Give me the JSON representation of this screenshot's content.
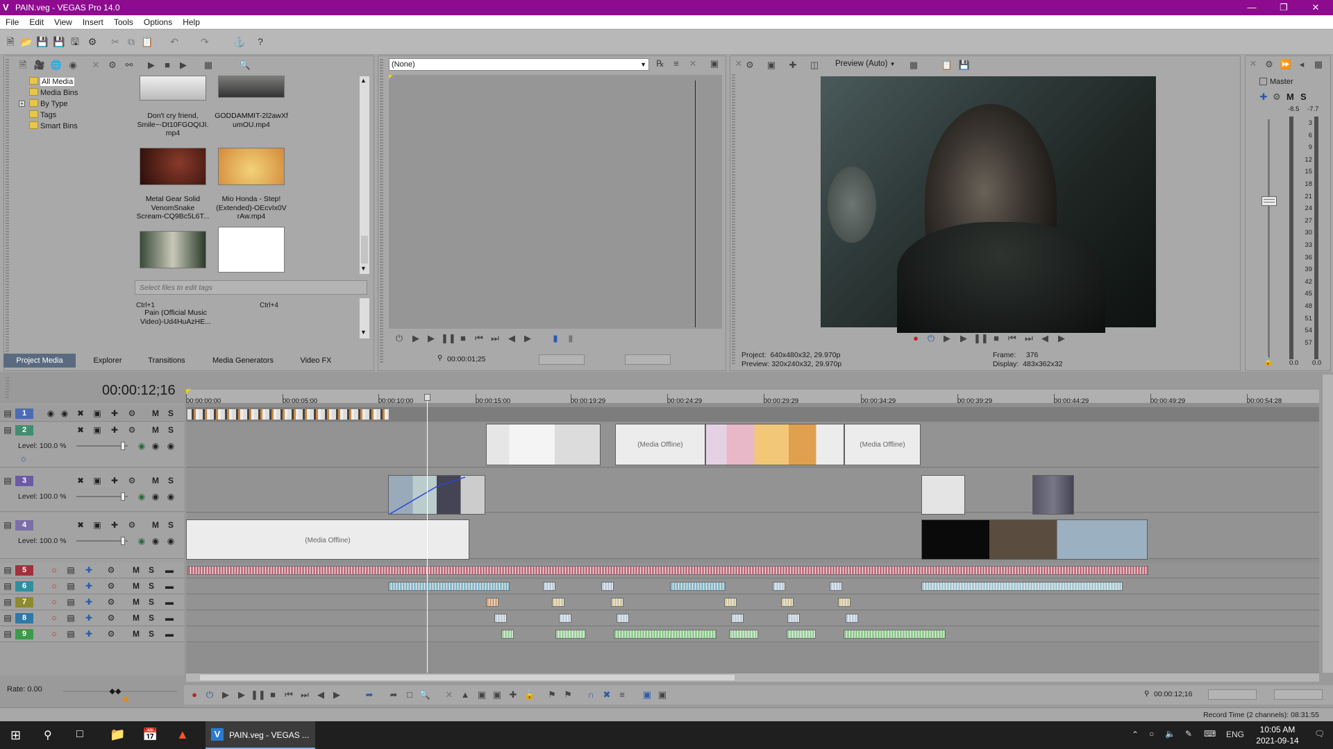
{
  "window": {
    "title": "PAIN.veg - VEGAS Pro 14.0",
    "accent": "#8e0a8e"
  },
  "menu": [
    "File",
    "Edit",
    "View",
    "Insert",
    "Tools",
    "Options",
    "Help"
  ],
  "project_media": {
    "tree": [
      "All Media",
      "Media Bins",
      "By Type",
      "Tags",
      "Smart Bins"
    ],
    "items": [
      {
        "caption": "Don't cry friend, Smile~-Dt10FGOQIJI.mp4",
        "lines": [
          "Don't cry friend,",
          "Smile~-Dt10FGOQIJI.",
          "mp4"
        ]
      },
      {
        "caption": "GODDAMMIT-2l2awXf umOU.mp4",
        "lines": [
          "GODDAMMIT-2l2awXf",
          "umOU.mp4"
        ]
      },
      {
        "caption": "Metal Gear Solid VenomSnake Scream-CQ9Bc5L6T...",
        "lines": [
          "Metal Gear Solid",
          "VenomSnake",
          "Scream-CQ9Bc5L6T..."
        ]
      },
      {
        "caption": "Mio Honda - Step! (Extended)-OEcvIx0V rAw.mp4",
        "lines": [
          "Mio Honda - Step!",
          "(Extended)-OEcvIx0V",
          "rAw.mp4"
        ]
      }
    ],
    "tags_placeholder": "Select files to edit tags",
    "tag_shortcuts": [
      "Ctrl+1",
      "Ctrl+4"
    ],
    "extra_caption_lines": [
      "Pain (Official Music",
      "Video)-Ud4HuAzHE..."
    ],
    "tabs": [
      "Project Media",
      "Explorer",
      "Transitions",
      "Media Generators",
      "Video FX"
    ]
  },
  "trimmer": {
    "selected": "(None)",
    "timecode": "00:00:01;25"
  },
  "preview": {
    "mode": "Preview (Auto)",
    "project_label": "Project:",
    "project_value": "640x480x32, 29.970p",
    "preview_label": "Preview:",
    "preview_value": "320x240x32, 29.970p",
    "frame_label": "Frame:",
    "frame_value": "376",
    "display_label": "Display:",
    "display_value": "483x362x32"
  },
  "master": {
    "title": "Master",
    "m": "M",
    "s": "S",
    "left_peak": "-8.5",
    "right_peak": "-7.7",
    "scale": [
      "3",
      "6",
      "9",
      "12",
      "15",
      "18",
      "21",
      "24",
      "27",
      "30",
      "33",
      "36",
      "39",
      "42",
      "45",
      "48",
      "51",
      "54",
      "57"
    ],
    "bottom_left": "0.0",
    "bottom_right": "0.0"
  },
  "timeline": {
    "cursor_time": "00:00:12;16",
    "ruler": [
      "00:00:00;00",
      "00:00:05;00",
      "00:00:10;00",
      "00:00:15;00",
      "00:00:19;29",
      "00:00:24;29",
      "00:00:29;29",
      "00:00:34;29",
      "00:00:39;29",
      "00:00:44;29",
      "00:00:49;29",
      "00:00:54;28"
    ],
    "video_tracks": [
      {
        "num": "1",
        "level": ""
      },
      {
        "num": "2",
        "level": "Level: 100.0 %"
      },
      {
        "num": "3",
        "level": "Level: 100.0 %"
      },
      {
        "num": "4",
        "level": "Level: 100.0 %"
      }
    ],
    "audio_tracks": [
      "5",
      "6",
      "7",
      "8",
      "9"
    ],
    "media_offline": "(Media Offline)",
    "media_offline_short": "(Media Offline)",
    "rate": "Rate: 0.00",
    "bottom_time": "00:00:12;16",
    "record_time": "Record Time (2 channels): 08:31:55"
  },
  "track_colors": {
    "t1": "#4b6bb5",
    "t2": "#3f8f6f",
    "t3": "#6c5aa5",
    "t4": "#7b6fa6",
    "a5": "#a32f3c",
    "a6": "#2f8fa0",
    "a7": "#8f8a2e",
    "a8": "#2f78a8",
    "a9": "#3d9a4a"
  },
  "taskbar": {
    "app_label": "PAIN.veg - VEGAS ...",
    "lang": "ENG",
    "time": "10:05 AM",
    "date": "2021-09-14"
  }
}
